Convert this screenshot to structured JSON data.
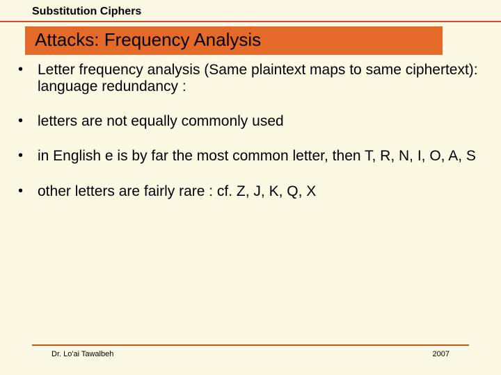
{
  "header": {
    "topic": "Substitution Ciphers",
    "title": "Attacks: Frequency Analysis"
  },
  "bullets": [
    "Letter frequency analysis (Same plaintext maps to same ciphertext): language redundancy :",
    "letters are not equally commonly used",
    "in English e is by far the most common letter, then T, R, N, I, O, A, S",
    "other letters are fairly rare :  cf. Z, J, K, Q, X"
  ],
  "footer": {
    "author": "Dr. Lo'ai Tawalbeh",
    "year": "2007"
  }
}
